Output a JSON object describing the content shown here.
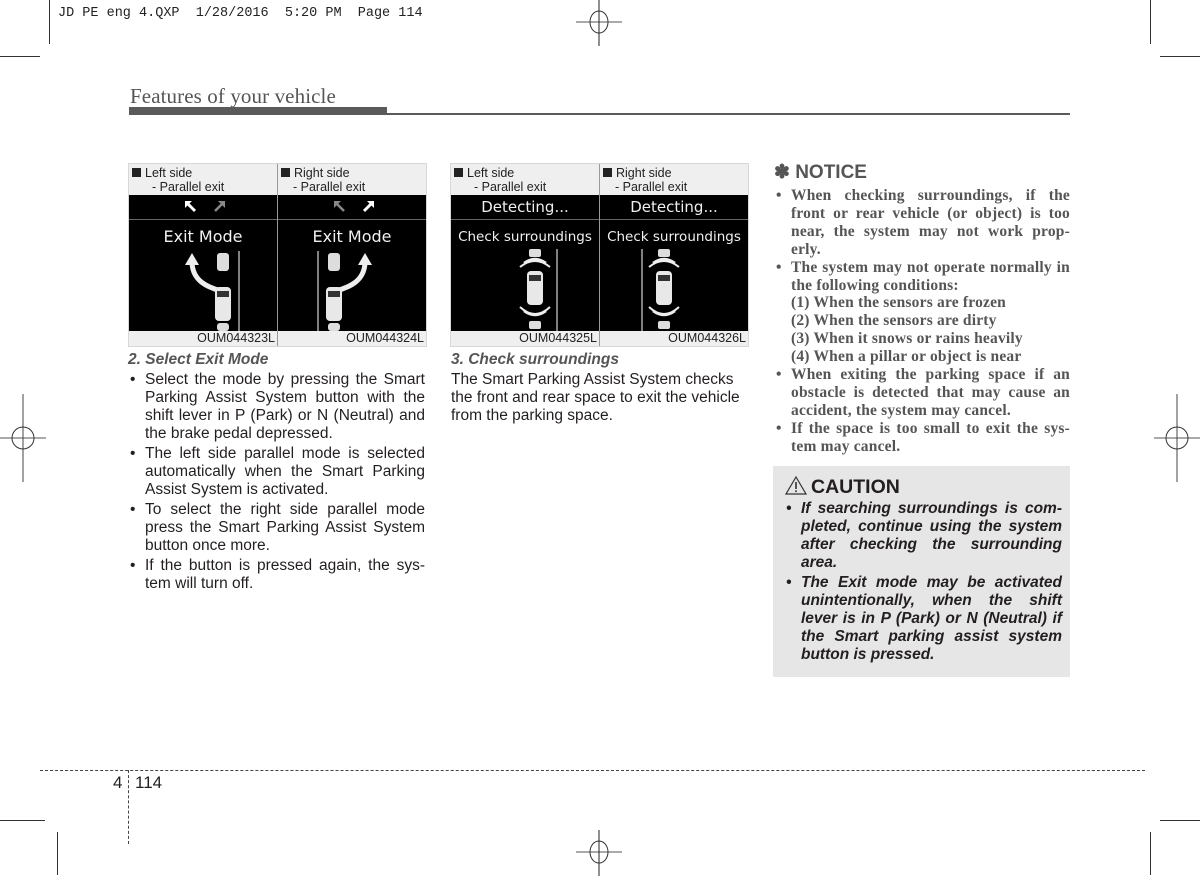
{
  "print_slug": "JD PE eng 4.QXP  1/28/2016  5:20 PM  Page 114",
  "header": {
    "title": "Features of your vehicle"
  },
  "figures": [
    {
      "panels": [
        {
          "side": "Left side",
          "mode": "- Parallel exit",
          "band_icons": "arrows-icon",
          "screen_text": "Exit Mode",
          "code": "OUM044323L",
          "direction": "left"
        },
        {
          "side": "Right side",
          "mode": "- Parallel exit",
          "band_icons": "arrows-icon",
          "screen_text": "Exit Mode",
          "code": "OUM044324L",
          "direction": "right"
        }
      ]
    },
    {
      "panels": [
        {
          "side": "Left side",
          "mode": "- Parallel exit",
          "band_text": "Detecting...",
          "screen_text": "Check surroundings",
          "code": "OUM044325L",
          "direction": "left"
        },
        {
          "side": "Right side",
          "mode": "- Parallel exit",
          "band_text": "Detecting...",
          "screen_text": "Check surroundings",
          "code": "OUM044326L",
          "direction": "right"
        }
      ]
    }
  ],
  "section2": {
    "heading": "2. Select Exit Mode",
    "bullets": [
      "Select the mode by pressing the Smart Parking Assist System button with the shift lever in P (Park) or N (Neutral) and the brake pedal depressed.",
      "The left side parallel mode is selected automatically when the Smart Parking Assist System is activated.",
      "To select the right side parallel mode press the Smart Parking Assist System button once more.",
      "If the button is pressed again, the sys-tem will turn off."
    ]
  },
  "section3": {
    "heading": "3. Check surroundings",
    "body": "The Smart Parking Assist System checks the front and rear space to exit the vehicle from the parking space."
  },
  "notice": {
    "icon": "asterisk-icon",
    "symbol": "✽",
    "title": "NOTICE",
    "bullet1": "When checking surroundings, if the front or rear vehicle (or object) is too near, the system may not work prop-erly.",
    "bullet2": "The system may not operate normally in the following conditions:",
    "conditions": [
      "(1) When the sensors are frozen",
      "(2) When the sensors are dirty",
      "(3) When it snows or rains heavily",
      "(4) When a pillar or object is near"
    ],
    "bullet3": "When exiting the parking space if an obstacle is detected that may cause an accident, the system may cancel.",
    "bullet4": "If the space is too small to exit the sys-tem may cancel."
  },
  "caution": {
    "icon": "warning-triangle-icon",
    "title": "CAUTION",
    "bullets": [
      "If searching surroundings is com-pleted, continue using the system after checking the surrounding area.",
      "The Exit mode may be activated unintentionally, when the shift lever is in P (Park) or N (Neutral) if the Smart parking assist system button is pressed."
    ]
  },
  "footer": {
    "chapter": "4",
    "page": "114"
  }
}
